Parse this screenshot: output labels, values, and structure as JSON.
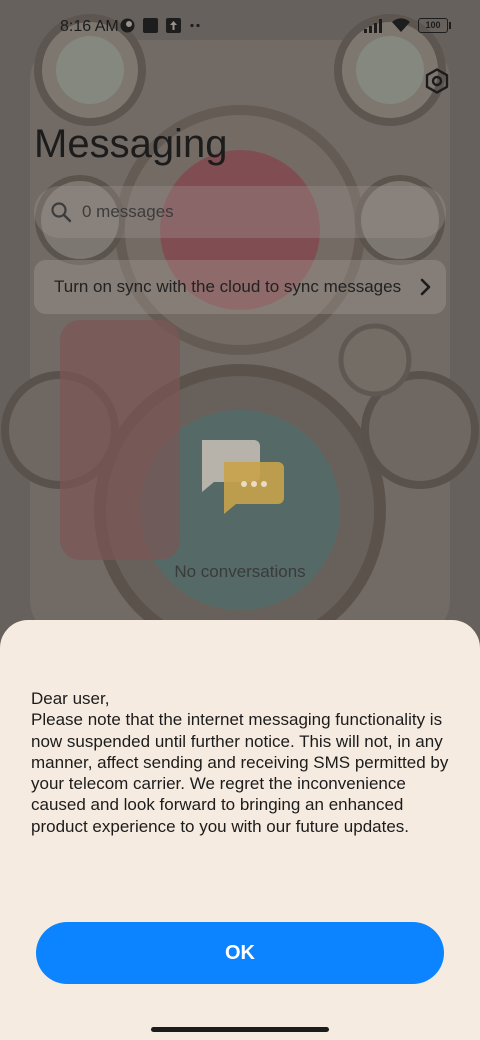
{
  "status_bar": {
    "time": "8:16 AM",
    "battery": "100",
    "icons_left": [
      "app-notification-icon",
      "square-notification-icon",
      "upload-notification-icon",
      "more-notifications-icon"
    ],
    "icons_right": [
      "signal-icon",
      "wifi-icon",
      "battery-icon"
    ]
  },
  "app": {
    "title": "Messaging",
    "search_placeholder": "0 messages",
    "sync_banner": "Turn on sync with the cloud to sync messages",
    "empty_state": "No conversations"
  },
  "dialog": {
    "message": "Dear user,\nPlease note that the internet messaging functionality is now suspended until further notice. This will not, in any manner, affect sending and receiving SMS permitted by your telecom carrier. We regret the inconvenience caused and look forward to bringing an enhanced product experience to you with our future updates.",
    "ok_label": "OK"
  },
  "colors": {
    "dialog_bg": "#f6ebe0",
    "accent": "#0d84ff"
  }
}
